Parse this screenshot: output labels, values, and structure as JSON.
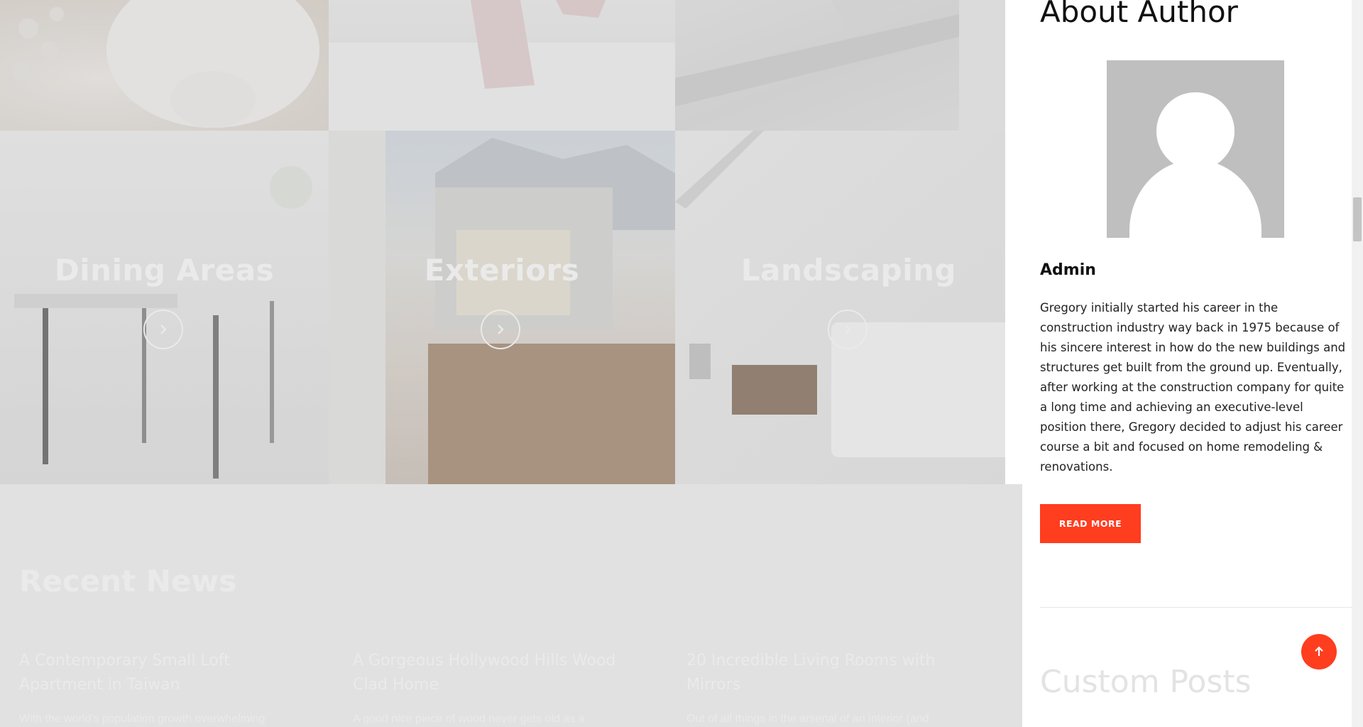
{
  "gallery": {
    "tiles": [
      {
        "label": "Dining Areas",
        "arrow_icon": "chevron-right-icon"
      },
      {
        "label": "Exteriors",
        "arrow_icon": "chevron-right-icon"
      },
      {
        "label": "Landscaping",
        "arrow_icon": "chevron-right-icon"
      }
    ]
  },
  "news": {
    "title": "Recent News",
    "items": [
      {
        "title": "A Contemporary Small Loft Apartment in Taiwan",
        "excerpt": "With the world's population growth overwhelming"
      },
      {
        "title": "A Gorgeous Hollywood Hills Wood Clad Home",
        "excerpt": "A good nice piece of wood never gets old as a"
      },
      {
        "title": "20 Incredible Living Rooms with Mirrors",
        "excerpt": "Out of all things in the arsenal of an interior (and"
      }
    ]
  },
  "sidebar": {
    "about_title": "About Author",
    "author_name": "Admin",
    "bio": "Gregory initially started his career in the construction industry way back in 1975 because of his sincere interest in how do the new buildings and structures get built from the ground up. Eventually, after working at the construction company for quite a long time and achieving an executive-level position there, Gregory decided to adjust his career course a bit and focused on home remodeling & renovations.",
    "read_more_label": "READ MORE",
    "custom_posts_title": "Custom Posts"
  },
  "colors": {
    "accent": "#ff3d1f",
    "avatar_bg": "#bfbfbf",
    "news_bg": "#f6f6f6"
  },
  "icons": {
    "back_to_top": "arrow-up-icon"
  }
}
